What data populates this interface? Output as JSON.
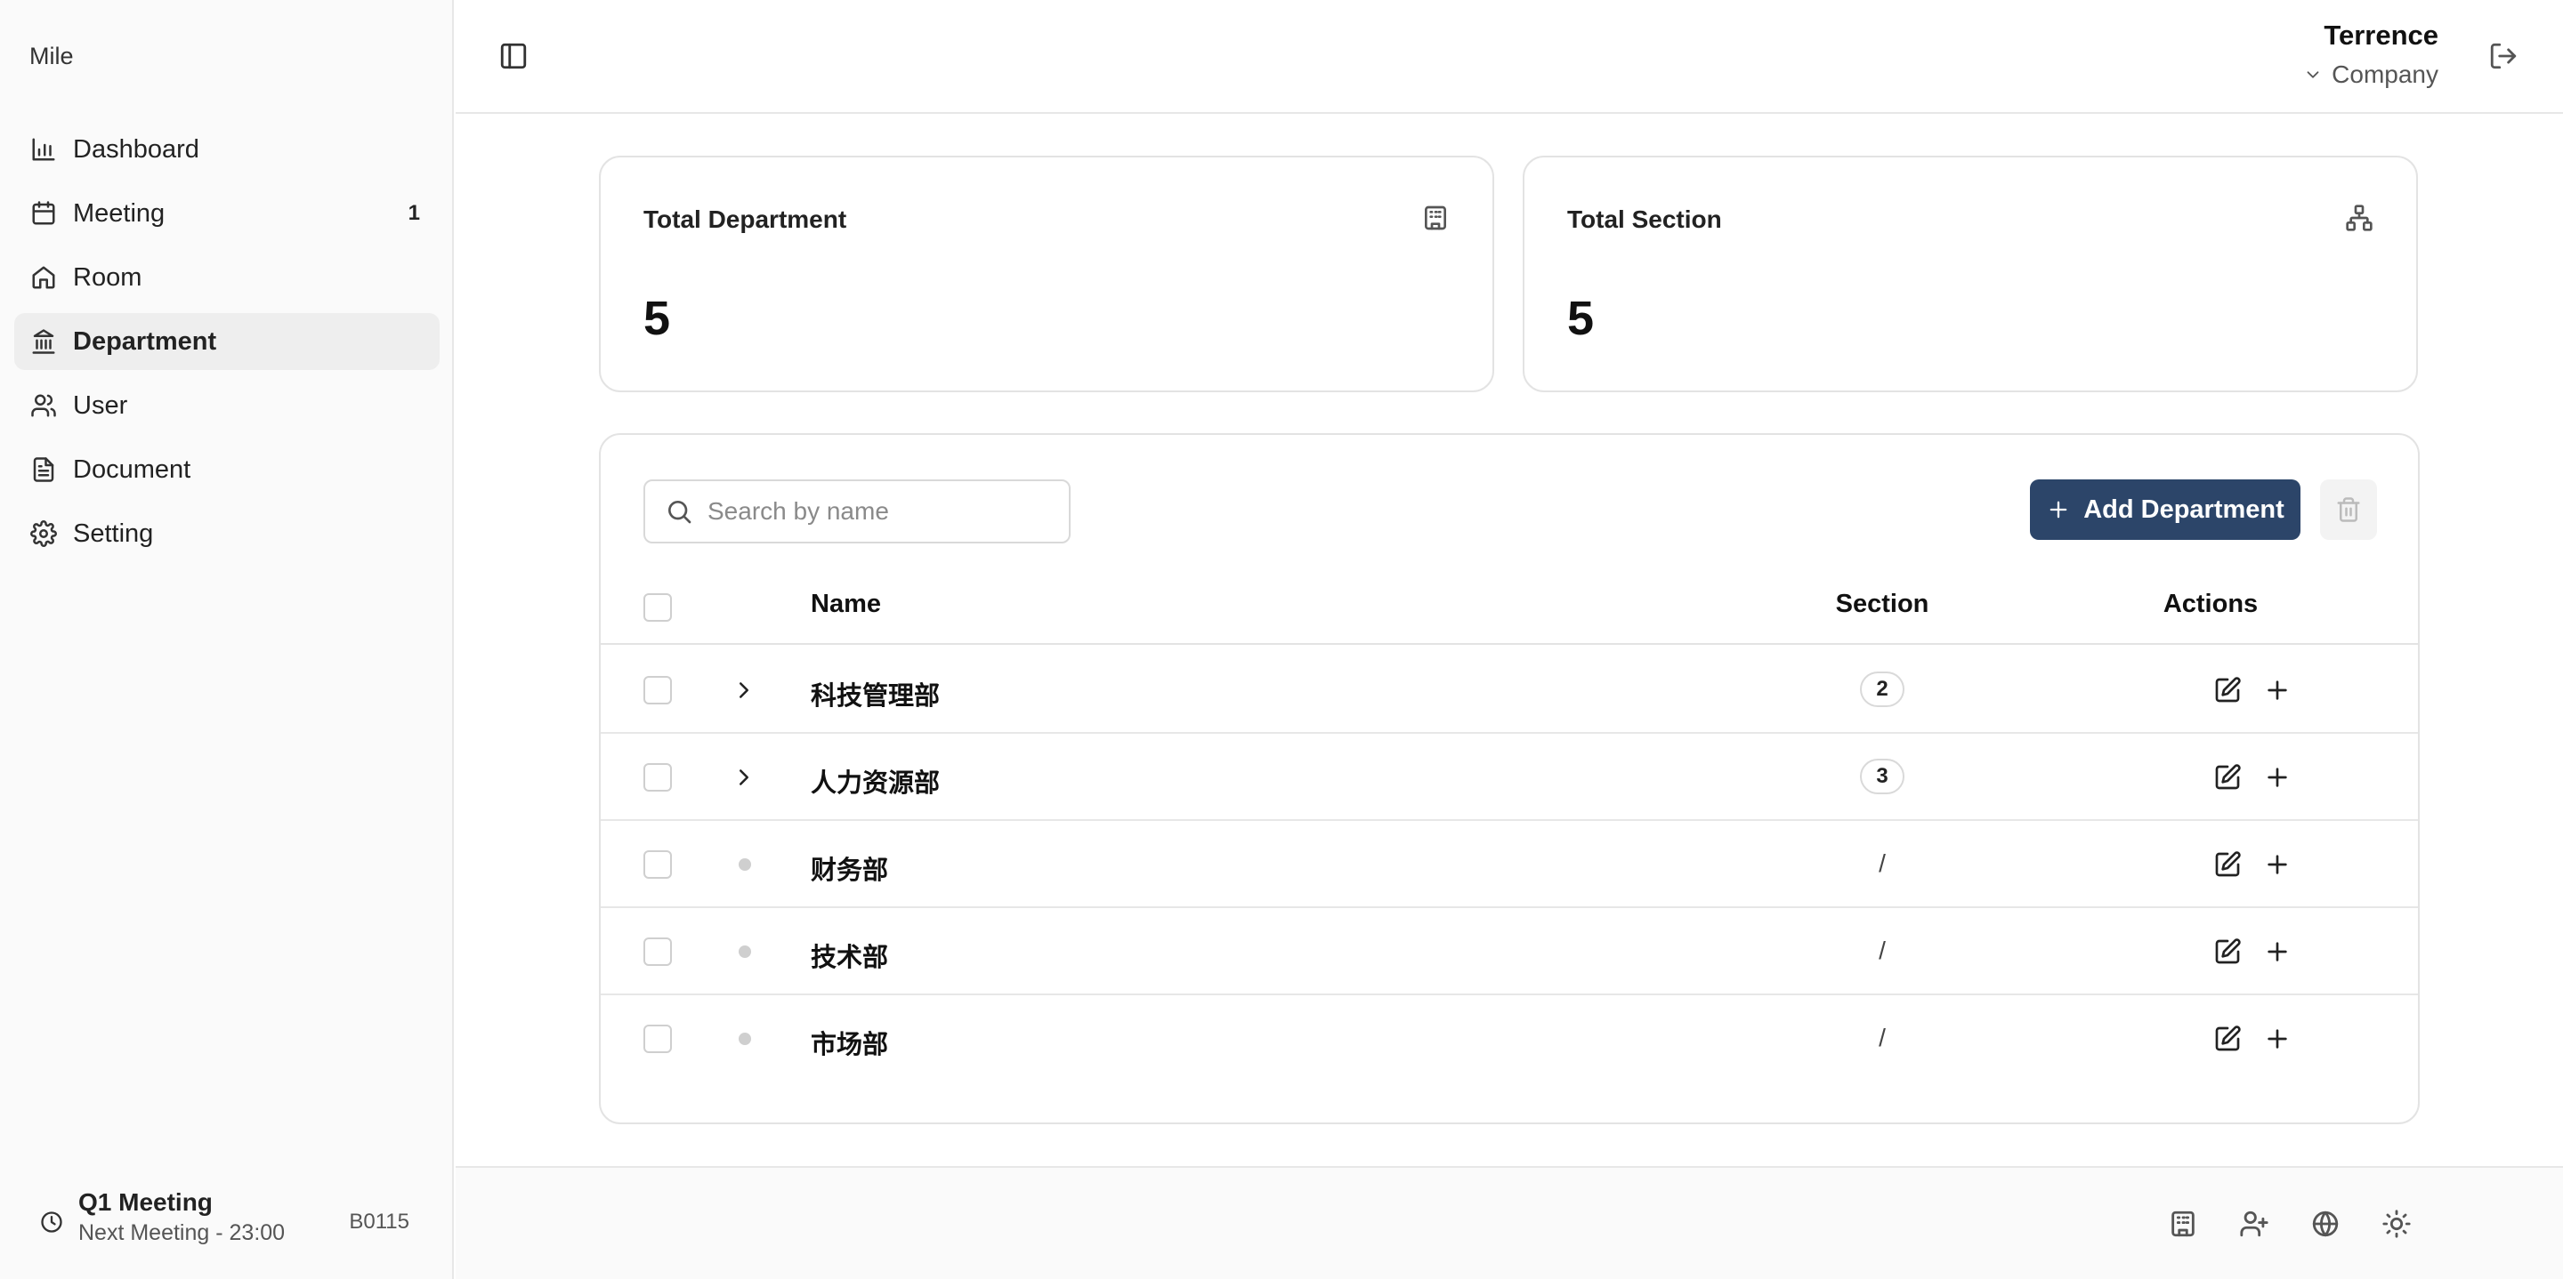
{
  "brand": "Mile",
  "sidebar": {
    "items": [
      {
        "label": "Dashboard",
        "icon": "bar-chart-icon",
        "badge": ""
      },
      {
        "label": "Meeting",
        "icon": "calendar-icon",
        "badge": "1"
      },
      {
        "label": "Room",
        "icon": "home-icon",
        "badge": ""
      },
      {
        "label": "Department",
        "icon": "landmark-icon",
        "badge": "",
        "active": true
      },
      {
        "label": "User",
        "icon": "users-icon",
        "badge": ""
      },
      {
        "label": "Document",
        "icon": "file-text-icon",
        "badge": ""
      },
      {
        "label": "Setting",
        "icon": "gear-icon",
        "badge": ""
      }
    ],
    "footer": {
      "meeting_title": "Q1 Meeting",
      "meeting_sub": "Next Meeting - 23:00",
      "room_code": "B0115"
    }
  },
  "header": {
    "user_name": "Terrence",
    "company_label": "Company"
  },
  "stats": [
    {
      "label": "Total Department",
      "value": "5",
      "icon": "building-icon"
    },
    {
      "label": "Total Section",
      "value": "5",
      "icon": "network-icon"
    }
  ],
  "toolbar": {
    "search_placeholder": "Search by name",
    "add_label": "Add Department"
  },
  "table": {
    "columns": {
      "name": "Name",
      "section": "Section",
      "actions": "Actions"
    },
    "rows": [
      {
        "name": "科技管理部",
        "section": "2",
        "expandable": true
      },
      {
        "name": "人力资源部",
        "section": "3",
        "expandable": true
      },
      {
        "name": "财务部",
        "section": "/",
        "expandable": false
      },
      {
        "name": "技术部",
        "section": "/",
        "expandable": false
      },
      {
        "name": "市场部",
        "section": "/",
        "expandable": false
      }
    ]
  },
  "colors": {
    "primary": "#2c4569",
    "sidebar_bg": "#fafafa",
    "active_item_bg": "#eeeeee",
    "border": "#e3e3e3"
  }
}
